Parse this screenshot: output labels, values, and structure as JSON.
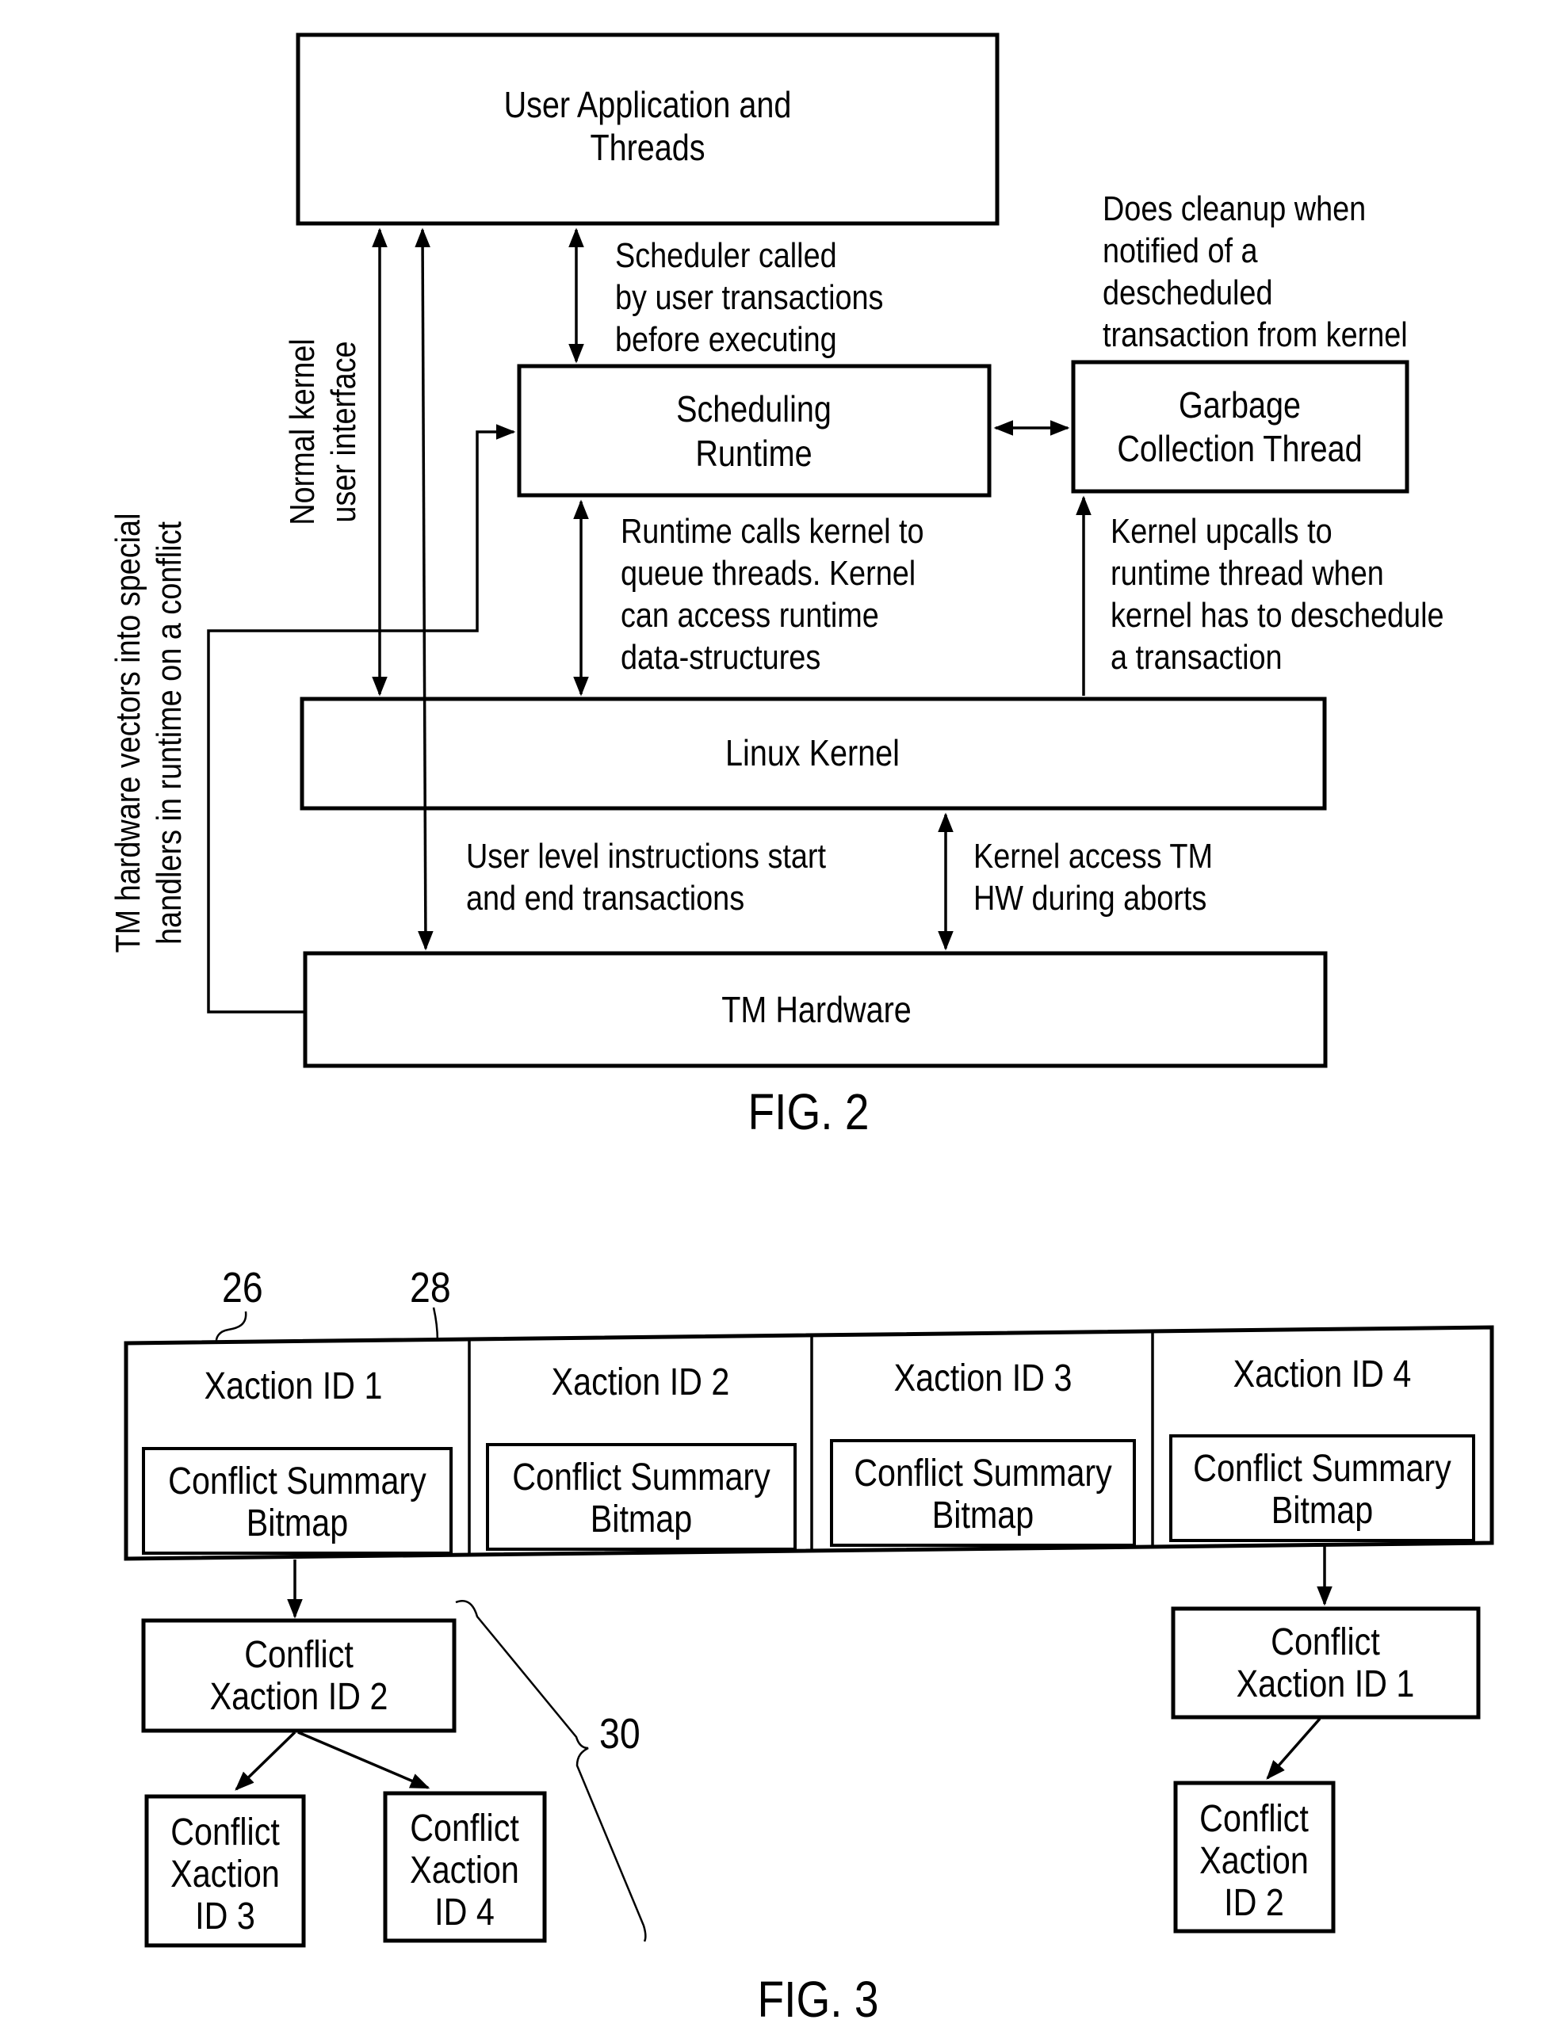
{
  "fig2": {
    "caption": "FIG. 2",
    "boxes": {
      "user_app": [
        "User Application and",
        "Threads"
      ],
      "scheduling_runtime": [
        "Scheduling",
        "Runtime"
      ],
      "garbage_collection": [
        "Garbage",
        "Collection Thread"
      ],
      "linux_kernel": [
        "Linux Kernel"
      ],
      "tm_hardware": [
        "TM Hardware"
      ]
    },
    "annotations": {
      "scheduler_called": [
        "Scheduler called",
        "by user transactions",
        "before executing"
      ],
      "does_cleanup": [
        "Does cleanup when",
        "notified of a",
        "descheduled",
        "transaction from kernel"
      ],
      "runtime_calls_kernel": [
        "Runtime calls kernel to",
        "queue threads. Kernel",
        "can access runtime",
        "data-structures"
      ],
      "kernel_upcalls": [
        "Kernel upcalls to",
        "runtime thread when",
        "kernel has to deschedule",
        "a transaction"
      ],
      "user_level_instructions": [
        "User level instructions start",
        "and end transactions"
      ],
      "kernel_access_tm": [
        "Kernel access TM",
        "HW during aborts"
      ],
      "normal_kernel_interface": [
        "Normal kernel",
        "user interface"
      ],
      "tm_hardware_vectors": [
        "TM hardware vectors into special",
        "handlers in runtime on a conflict"
      ]
    }
  },
  "fig3": {
    "caption": "FIG. 3",
    "ref_labels": {
      "table": "26",
      "bitmap": "28",
      "tree": "30"
    },
    "transactions": [
      {
        "id_label": "Xaction ID 1",
        "bitmap": [
          "Conflict Summary",
          "Bitmap"
        ]
      },
      {
        "id_label": "Xaction ID 2",
        "bitmap": [
          "Conflict Summary",
          "Bitmap"
        ]
      },
      {
        "id_label": "Xaction ID 3",
        "bitmap": [
          "Conflict Summary",
          "Bitmap"
        ]
      },
      {
        "id_label": "Xaction ID 4",
        "bitmap": [
          "Conflict Summary",
          "Bitmap"
        ]
      }
    ],
    "conflict_nodes": {
      "x1_conflict_2": [
        "Conflict",
        "Xaction ID 2"
      ],
      "x1_conflict_3": [
        "Conflict",
        "Xaction",
        "ID 3"
      ],
      "x1_conflict_4": [
        "Conflict",
        "Xaction",
        "ID 4"
      ],
      "x4_conflict_1": [
        "Conflict",
        "Xaction ID 1"
      ],
      "x4_conflict_2": [
        "Conflict",
        "Xaction",
        "ID 2"
      ]
    }
  }
}
